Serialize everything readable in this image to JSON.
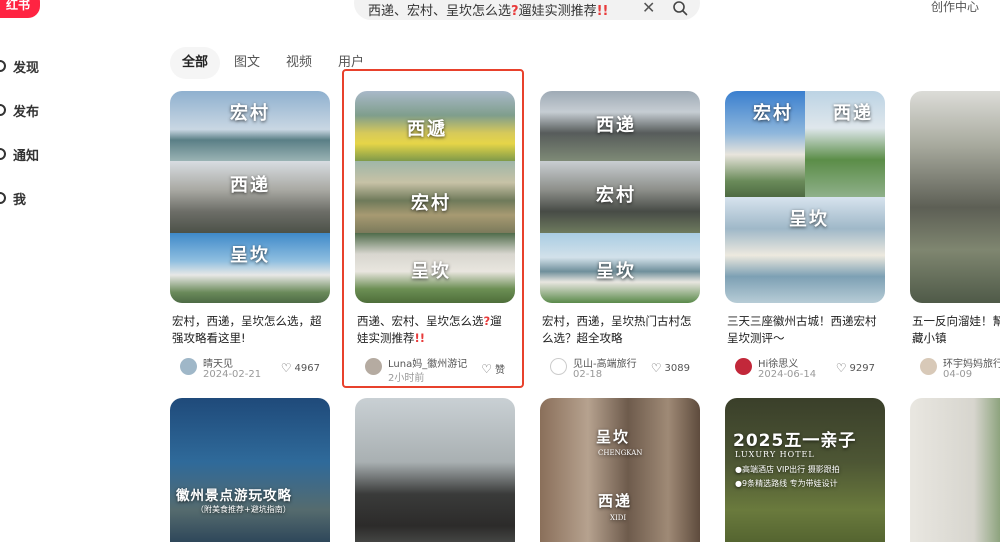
{
  "logo": {
    "text": "红书"
  },
  "search": {
    "query_prefix": "西递、宏村、呈坎怎么选",
    "query_mark": "?",
    "query_suffix": "遛娃实测推荐",
    "query_end": "!!"
  },
  "header": {
    "creator_center": "创作中心"
  },
  "sidebar": {
    "items": [
      {
        "label": "发现",
        "icon": "compass-icon"
      },
      {
        "label": "发布",
        "icon": "plus-icon"
      },
      {
        "label": "通知",
        "icon": "bell-icon"
      },
      {
        "label": "我",
        "icon": "avatar-icon"
      }
    ]
  },
  "tabs": [
    {
      "label": "全部",
      "active": true
    },
    {
      "label": "图文"
    },
    {
      "label": "视频"
    },
    {
      "label": "用户"
    }
  ],
  "cards": [
    {
      "thumb_labels": [
        "宏村",
        "西递",
        "呈坎"
      ],
      "title": "宏村，西递，呈坎怎么选，超强攻略看这里!",
      "author": "晴天见",
      "date": "2024-02-21",
      "likes": "4967"
    },
    {
      "thumb_labels": [
        "西遞",
        "宏村",
        "呈坎"
      ],
      "title_a": "西递、宏村、呈坎怎么选",
      "title_mark": "?",
      "title_b": "遛娃实测推荐",
      "title_end": "!!",
      "author": "Luna妈_徽州游记",
      "date": "2小时前",
      "likes": "赞"
    },
    {
      "thumb_labels": [
        "西递",
        "宏村",
        "呈坎"
      ],
      "title": "宏村，西递，呈坎热门古村怎么选？超全攻略",
      "author": "见山-高端旅行",
      "date": "02-18",
      "likes": "3089"
    },
    {
      "thumb_labels": [
        "宏村",
        "西递",
        "呈坎"
      ],
      "title": "三天三座徽州古城！西递宏村呈坎测评～",
      "author": "Hi徐思义",
      "date": "2024-06-14",
      "likes": "9297"
    },
    {
      "title": "五一反向溜娃！幫被低估的宝藏小镇",
      "author": "环宇妈妈旅行",
      "date": "04-09",
      "likes": ""
    }
  ],
  "row2": [
    {
      "text": "徽州景点游玩攻略",
      "subtext": "（附美食推荐+避坑指南）"
    },
    {
      "text": ""
    },
    {
      "labels": [
        "呈坎",
        "CHENGKAN",
        "西递",
        "XIDI"
      ]
    },
    {
      "headline": "2025五一亲子",
      "line1": "LUXURY HOTEL",
      "line2": "●高端酒店 VIP出行 摄影跟拍",
      "line3": "●9条精选路线 专为带娃设计"
    },
    {
      "text": ""
    }
  ]
}
